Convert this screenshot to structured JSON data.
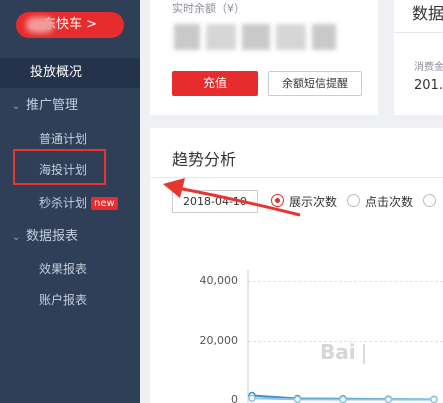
{
  "sidebar": {
    "brand_button": "东快车 >",
    "overview": "投放概况",
    "groups": [
      {
        "label": "推广管理",
        "items": [
          "普通计划",
          "海投计划",
          "秒杀计划"
        ]
      },
      {
        "label": "数据报表",
        "items": [
          "效果报表",
          "账户报表"
        ]
      }
    ],
    "new_badge": "new"
  },
  "balance": {
    "title": "实时余额（¥）",
    "recharge_button": "充值",
    "sms_button": "余额短信提醒"
  },
  "data_panel": {
    "title": "数据",
    "consume_label": "消费金",
    "consume_value": "201."
  },
  "trend": {
    "title": "趋势分析",
    "date_value": "2018-04-10",
    "metric_options": [
      {
        "label": "展示次数",
        "checked": true
      },
      {
        "label": "点击次数",
        "checked": false
      }
    ]
  },
  "chart_data": {
    "type": "line",
    "y_ticks": [
      "40,000",
      "20,000",
      "0"
    ],
    "ylim": [
      0,
      40000
    ],
    "series": [
      {
        "color": "#3d8fc4",
        "values": [
          1500,
          500,
          400,
          300,
          200
        ]
      },
      {
        "color": "#8fc4e6",
        "values": [
          600,
          200,
          150,
          150,
          120
        ]
      }
    ]
  },
  "colors": {
    "sidebar_bg": "#2f3f58",
    "accent_red": "#e62c2c"
  }
}
